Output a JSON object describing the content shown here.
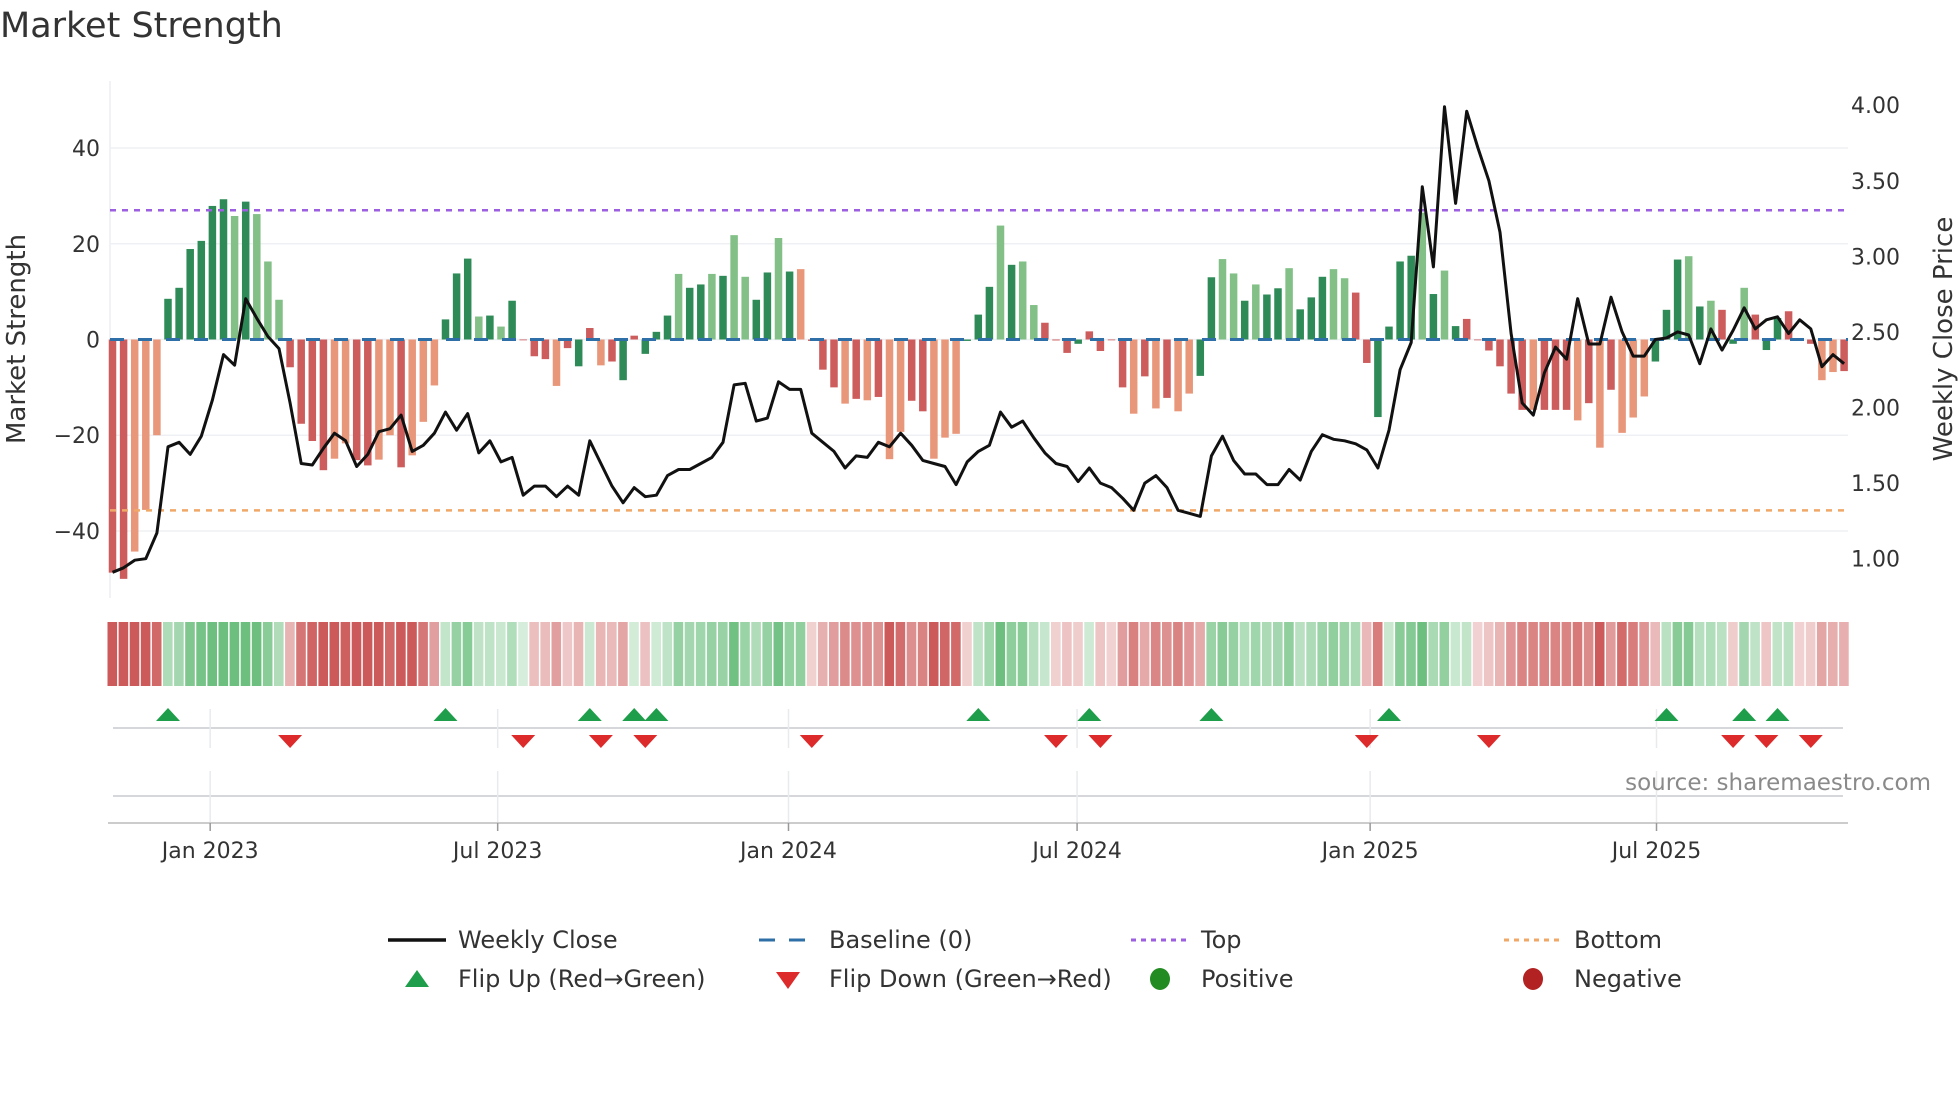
{
  "title": "Market Strength",
  "source": "source: sharemaestro.com",
  "chart_data": {
    "type": "bar",
    "title": "Market Strength",
    "ylabel": "Market Strength",
    "y2label": "Weekly Close Price",
    "ylim": [
      -54,
      54
    ],
    "y2lim": [
      0.74,
      4.16
    ],
    "yticks": [
      40,
      20,
      0,
      -20,
      -40
    ],
    "ytick_labels": [
      "40",
      "20",
      "0",
      "−20",
      "−40"
    ],
    "y2ticks": [
      4.0,
      3.5,
      3.0,
      2.5,
      2.0,
      1.5,
      1.0
    ],
    "y2tick_labels": [
      "4.00",
      "3.50",
      "3.00",
      "2.50",
      "2.00",
      "1.50",
      "1.00"
    ],
    "xticks_week_index": [
      8.8,
      34.7,
      60.9,
      86.9,
      113.3,
      139.1
    ],
    "xtick_labels": [
      "Jan 2023",
      "Jul 2023",
      "Jan 2024",
      "Jul 2024",
      "Jan 2025",
      "Jul 2025"
    ],
    "top_level": 27,
    "bottom_level": -35.7,
    "baseline": 0,
    "colors": {
      "G": "#2e8b57",
      "g": "#82c087",
      "R": "#cd5c5c",
      "r": "#e9977a",
      "close": "#111111",
      "baseline": "#2f6fa7",
      "top": "#9b5fe0",
      "bottom": "#f0a868",
      "flip_up": "#1e9e4a",
      "flip_down": "#dd2a2a",
      "positive": "#228b22",
      "negative": "#b22222"
    },
    "strength": [
      -48.7,
      -50,
      -44.3,
      -35.6,
      -20,
      8.5,
      10.8,
      18.9,
      20.6,
      27.9,
      29.3,
      25.8,
      28.8,
      26.2,
      16.3,
      8.3,
      -5.8,
      -17.6,
      -21.2,
      -27.3,
      -24.9,
      -21.7,
      -25.2,
      -26.3,
      -25.1,
      -20,
      -26.7,
      -24.2,
      -17.2,
      -9.6,
      4.2,
      13.8,
      16.9,
      4.8,
      5,
      2.7,
      8.1,
      0,
      -3.5,
      -4.1,
      -9.7,
      -1.8,
      -5.6,
      2.4,
      -5.4,
      -4.6,
      -8.5,
      0.8,
      -3,
      1.6,
      5,
      13.7,
      10.8,
      11.5,
      13.7,
      13.3,
      21.8,
      13.1,
      8.3,
      14,
      21.2,
      14.2,
      14.7,
      -0.3,
      -6.3,
      -10,
      -13.4,
      -12.4,
      -12.7,
      -12,
      -25,
      -19.3,
      -12.8,
      -15,
      -24.9,
      -20.5,
      -19.7,
      -0.3,
      5.2,
      11,
      23.8,
      15.6,
      16.3,
      7.2,
      3.5,
      -0.2,
      -2.8,
      -0.9,
      1.7,
      -2.4,
      -0.1,
      -10,
      -15.5,
      -7.7,
      -14.4,
      -12.2,
      -15,
      -11.3,
      -7.6,
      13,
      16.8,
      13.8,
      8.1,
      11.5,
      9.4,
      10.7,
      14.9,
      6.3,
      8.8,
      13.1,
      14.7,
      12.8,
      9.8,
      -4.9,
      -16.2,
      2.7,
      16.3,
      17.5,
      26.5,
      9.5,
      14.4,
      2.8,
      4.3,
      -0.1,
      -2.3,
      -5.6,
      -11.3,
      -14.7,
      -14.7,
      -14.7,
      -14.7,
      -14.7,
      -16.9,
      -13.3,
      -22.6,
      -10.5,
      -19.5,
      -16.3,
      -11.9,
      -4.6,
      6.2,
      16.7,
      17.4,
      6.9,
      8.1,
      6.2,
      -0.9,
      10.8,
      5.2,
      -2.2,
      4.5,
      5.9,
      -0.1,
      -0.9,
      -8.5,
      -6.8,
      -6.6
    ],
    "shade": "RRrrrGGGGGGgGggg RRRRrrRRrrRrrrGGGgGgGRRRrRGRrRGRGGGgGGgGggGGgGrRRRrRrRrrRRrrrGGGgGggRRRGRRRRrRrRrrGGggGgGGgGGGggRRGGGGgGgGRRRRRRrRRRrRrRrrrGGGgGgRGgRGGRRRrr",
    "weekly_close": [
      0.91,
      0.94,
      0.99,
      1.0,
      1.17,
      1.74,
      1.77,
      1.69,
      1.81,
      2.05,
      2.35,
      2.28,
      2.72,
      2.59,
      2.47,
      2.39,
      2.03,
      1.63,
      1.62,
      1.73,
      1.83,
      1.78,
      1.61,
      1.69,
      1.84,
      1.86,
      1.95,
      1.71,
      1.75,
      1.83,
      1.97,
      1.85,
      1.96,
      1.7,
      1.78,
      1.64,
      1.67,
      1.42,
      1.48,
      1.48,
      1.41,
      1.48,
      1.42,
      1.78,
      1.63,
      1.48,
      1.37,
      1.47,
      1.41,
      1.42,
      1.55,
      1.59,
      1.59,
      1.63,
      1.67,
      1.77,
      2.15,
      2.16,
      1.91,
      1.93,
      2.17,
      2.12,
      2.12,
      1.83,
      1.77,
      1.71,
      1.6,
      1.68,
      1.67,
      1.77,
      1.74,
      1.83,
      1.75,
      1.65,
      1.63,
      1.61,
      1.49,
      1.64,
      1.71,
      1.75,
      1.97,
      1.87,
      1.91,
      1.8,
      1.7,
      1.63,
      1.61,
      1.51,
      1.6,
      1.5,
      1.47,
      1.4,
      1.32,
      1.5,
      1.55,
      1.47,
      1.32,
      1.3,
      1.28,
      1.68,
      1.81,
      1.65,
      1.56,
      1.56,
      1.49,
      1.49,
      1.59,
      1.52,
      1.71,
      1.82,
      1.79,
      1.78,
      1.76,
      1.72,
      1.6,
      1.85,
      2.25,
      2.43,
      3.46,
      2.93,
      3.99,
      3.35,
      3.96,
      3.72,
      3.5,
      3.16,
      2.49,
      2.03,
      1.95,
      2.23,
      2.4,
      2.32,
      2.72,
      2.42,
      2.42,
      2.73,
      2.5,
      2.34,
      2.34,
      2.45,
      2.46,
      2.5,
      2.48,
      2.29,
      2.52,
      2.38,
      2.51,
      2.66,
      2.52,
      2.58,
      2.6,
      2.49,
      2.58,
      2.52,
      2.27,
      2.35,
      2.29
    ],
    "flip_up_week_index": [
      5,
      30,
      43,
      47,
      49,
      78,
      88,
      99,
      115,
      140,
      147,
      150
    ],
    "flip_down_week_index": [
      16,
      37,
      44,
      48,
      63,
      85,
      89,
      113,
      124,
      146,
      149,
      153
    ],
    "positive_week_index": [],
    "negative_week_index": [],
    "legend": {
      "placement": "bottom",
      "entries": [
        "Weekly Close",
        "Baseline (0)",
        "Top",
        "Bottom",
        "Flip Up (Red→Green)",
        "Flip Down (Green→Red)",
        "Positive",
        "Negative"
      ]
    }
  }
}
